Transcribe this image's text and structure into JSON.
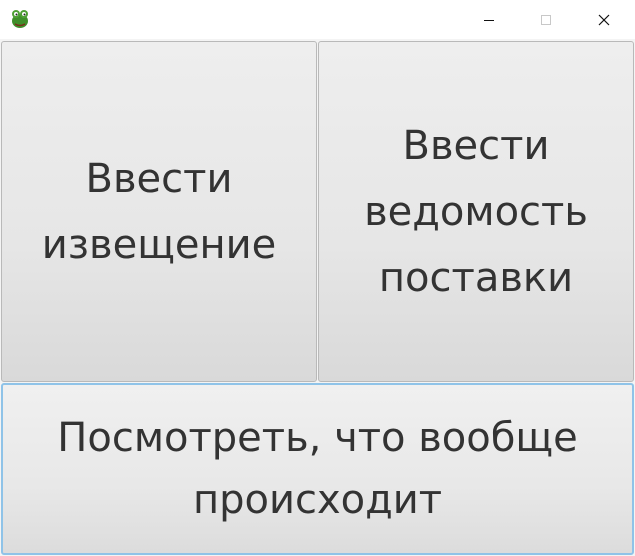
{
  "window": {
    "icon": "frog-icon",
    "controls": {
      "minimize": "minimize-icon",
      "maximize": "maximize-icon",
      "close": "close-icon"
    }
  },
  "buttons": {
    "notice_label": "Ввести\nизвещение",
    "statement_label": "Ввести\nведомость\nпоставки",
    "overview_label": "Посмотреть, что вообще\nпроисходит"
  },
  "colors": {
    "button_text": "#333333",
    "focus_border": "#8fc3e8",
    "icon_green": "#3f8f2a"
  }
}
